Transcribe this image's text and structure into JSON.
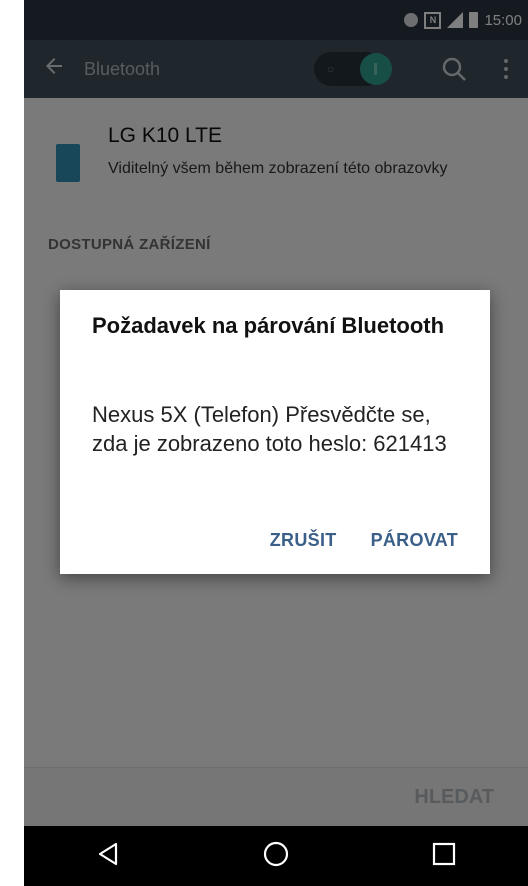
{
  "status_bar": {
    "time": "15:00",
    "icons": [
      "bluetooth-icon",
      "nfc-icon",
      "signal-icon",
      "battery-icon"
    ]
  },
  "app_bar": {
    "title": "Bluetooth",
    "toggle_state": "on",
    "icons": [
      "back-arrow-icon",
      "search-icon",
      "more-vert-icon"
    ]
  },
  "device": {
    "name": "LG K10 LTE",
    "visibility": "Viditelný všem během zobrazení této obrazovky"
  },
  "section": {
    "available_devices": "DOSTUPNÁ ZAŘÍZENÍ"
  },
  "dialog": {
    "title": "Požadavek na párování Bluetooth",
    "message": "Nexus 5X (Telefon) Přesvědčte se, zda je zobrazeno toto heslo: 621413",
    "cancel_label": "ZRUŠIT",
    "pair_label": "PÁROVAT"
  },
  "bottom_bar": {
    "search_label": "HLEDAT"
  },
  "nav_bar": {
    "icons": [
      "back-triangle-icon",
      "home-circle-icon",
      "recents-square-icon"
    ]
  },
  "colors": {
    "status_bar": "#2b3540",
    "app_bar": "#3f4e59",
    "accent": "#2e9e8c",
    "dialog_button": "#3a5f88"
  }
}
